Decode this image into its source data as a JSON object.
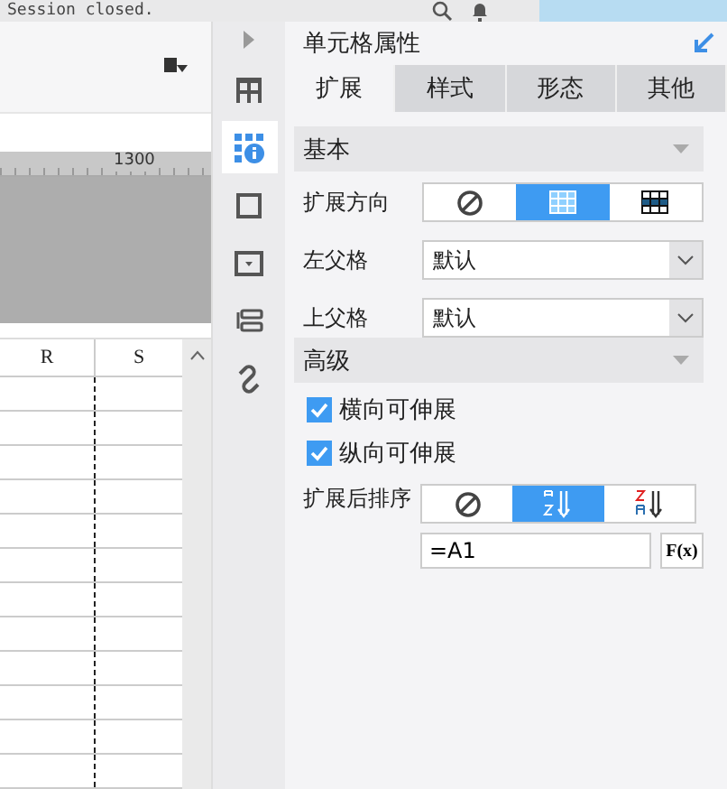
{
  "top_bar": {
    "message": "Session closed."
  },
  "sheet": {
    "ruler_label": "1300",
    "columns": [
      "R",
      "S"
    ]
  },
  "side_tools": [
    {
      "kind": "grid",
      "selected": false
    },
    {
      "kind": "info",
      "selected": true
    },
    {
      "kind": "square",
      "selected": false
    },
    {
      "kind": "dropdown",
      "selected": false
    },
    {
      "kind": "widget",
      "selected": false
    },
    {
      "kind": "link",
      "selected": false
    }
  ],
  "panel": {
    "title": "单元格属性",
    "tabs": [
      {
        "label": "扩展",
        "selected": true
      },
      {
        "label": "样式",
        "selected": false
      },
      {
        "label": "形态",
        "selected": false
      },
      {
        "label": "其他",
        "selected": false
      }
    ],
    "basic": {
      "title": "基本",
      "direction": {
        "label": "扩展方向",
        "options": [
          {
            "kind": "none",
            "selected": false
          },
          {
            "kind": "vertical",
            "selected": true
          },
          {
            "kind": "horizontal",
            "selected": false
          }
        ]
      },
      "left_parent": {
        "label": "左父格",
        "value": "默认"
      },
      "top_parent": {
        "label": "上父格",
        "value": "默认"
      }
    },
    "advanced": {
      "title": "高级",
      "checks": [
        {
          "label": "横向可伸展",
          "checked": true
        },
        {
          "label": "纵向可伸展",
          "checked": true
        }
      ],
      "sort": {
        "label": "扩展后排序",
        "options": [
          {
            "kind": "none",
            "selected": false
          },
          {
            "kind": "asc",
            "selected": true
          },
          {
            "kind": "desc",
            "selected": false
          }
        ]
      },
      "formula": "=A1",
      "fx_label": "F(x)"
    }
  }
}
